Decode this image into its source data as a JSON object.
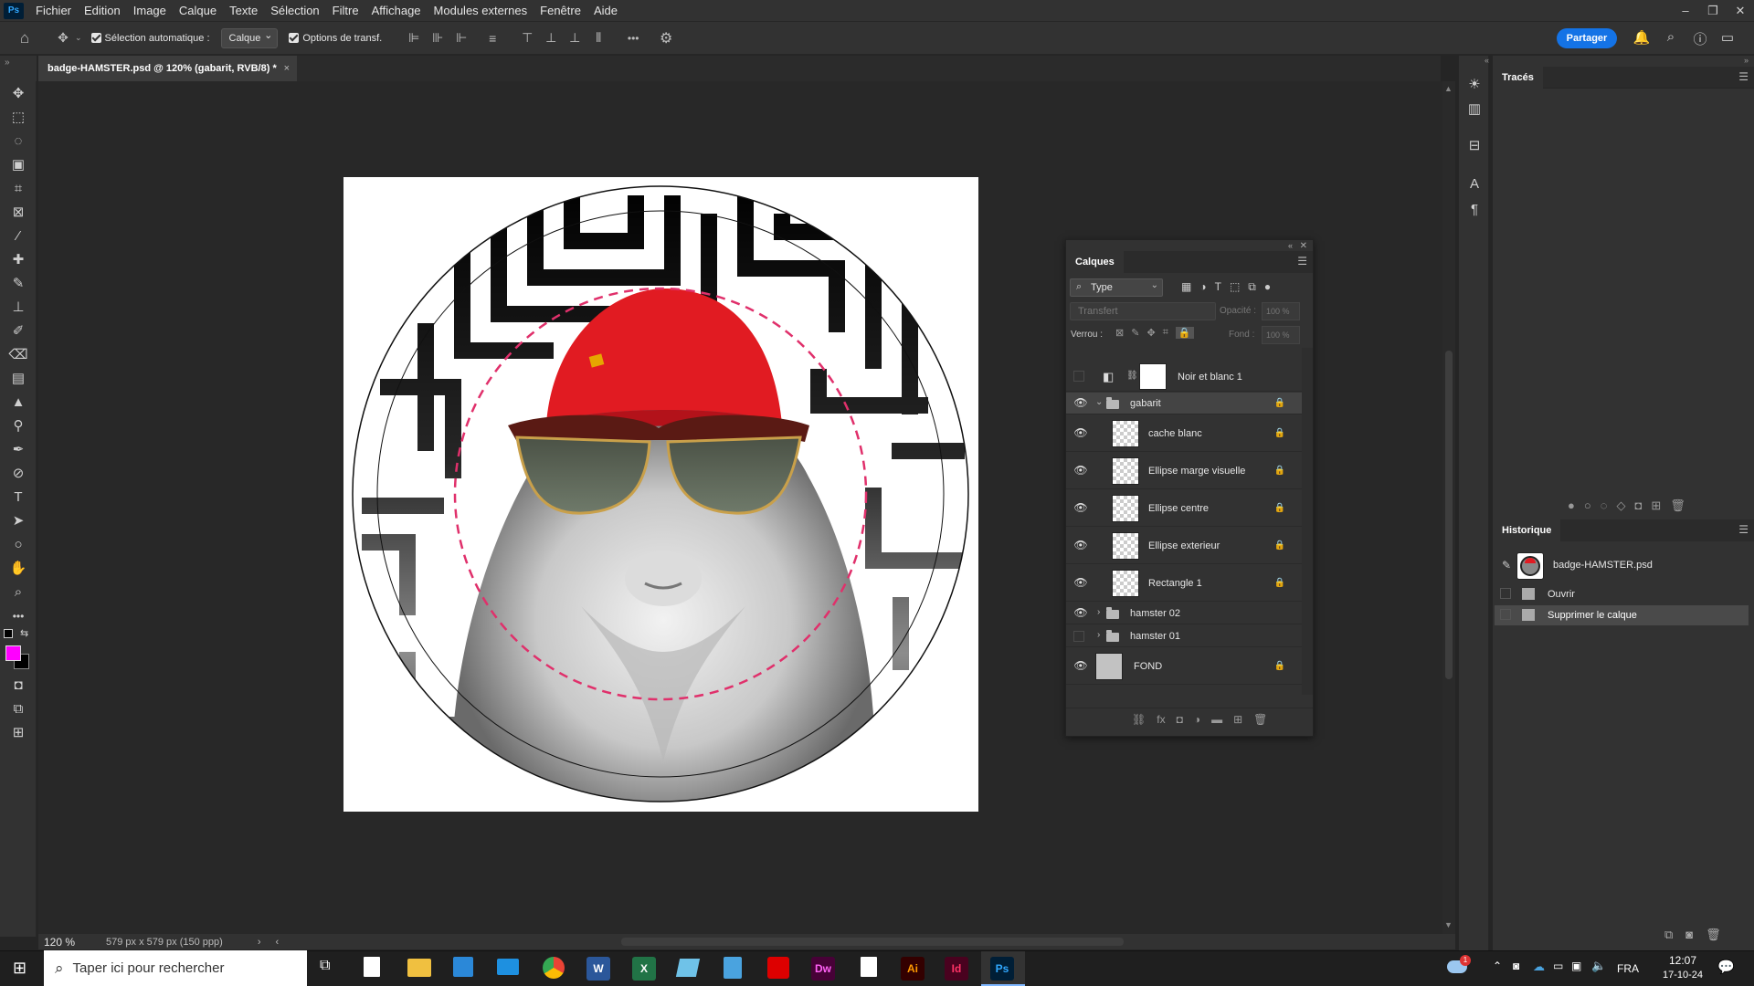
{
  "menu": {
    "logo": "Ps",
    "items": [
      "Fichier",
      "Edition",
      "Image",
      "Calque",
      "Texte",
      "Sélection",
      "Filtre",
      "Affichage",
      "Modules externes",
      "Fenêtre",
      "Aide"
    ]
  },
  "options": {
    "auto_select_label": "Sélection automatique :",
    "auto_select_value": "Calque",
    "transform_label": "Options de transf.",
    "more_label": "•••"
  },
  "header": {
    "share_label": "Partager"
  },
  "document": {
    "tab_title": "badge-HAMSTER.psd @ 120% (gabarit, RVB/8) *",
    "close": "×"
  },
  "status": {
    "zoom": "120 %",
    "info": "579 px x 579 px (150 ppp)"
  },
  "layers_panel": {
    "title": "Calques",
    "filter_value": "Type",
    "blend_mode": "Transfert",
    "opacity_label": "Opacité :",
    "opacity_value": "100 %",
    "lock_label": "Verrou :",
    "fill_label": "Fond :",
    "fill_value": "100 %",
    "layers": [
      {
        "name": "Noir et blanc 1",
        "visible": false,
        "type": "adjustment"
      },
      {
        "name": "gabarit",
        "visible": true,
        "type": "group",
        "locked": true
      },
      {
        "name": "cache blanc",
        "visible": true,
        "type": "layer",
        "locked": true
      },
      {
        "name": "Ellipse marge visuelle",
        "visible": true,
        "type": "shape",
        "locked": true
      },
      {
        "name": "Ellipse centre",
        "visible": true,
        "type": "shape",
        "locked": true
      },
      {
        "name": "Ellipse exterieur",
        "visible": true,
        "type": "shape",
        "locked": true
      },
      {
        "name": "Rectangle 1",
        "visible": true,
        "type": "shape",
        "locked": true
      },
      {
        "name": "hamster 02",
        "visible": true,
        "type": "group"
      },
      {
        "name": "hamster 01",
        "visible": false,
        "type": "group"
      },
      {
        "name": "FOND",
        "visible": true,
        "type": "background",
        "locked": true
      }
    ]
  },
  "paths_panel": {
    "title": "Tracés"
  },
  "history_panel": {
    "title": "Historique",
    "snapshot": "badge-HAMSTER.psd",
    "steps": [
      "Ouvrir",
      "Supprimer le calque"
    ]
  },
  "colors": {
    "foreground": "#ff00ff",
    "background": "#000000",
    "accent": "#1473e6",
    "guide": "#e0306b"
  },
  "taskbar": {
    "search_placeholder": "Taper ici pour rechercher",
    "apps": [
      "W",
      "X",
      "Dw",
      "Ai",
      "Id",
      "Ps"
    ],
    "lang": "FRA",
    "time": "12:07",
    "date": "17-10-24",
    "badge": "1"
  }
}
